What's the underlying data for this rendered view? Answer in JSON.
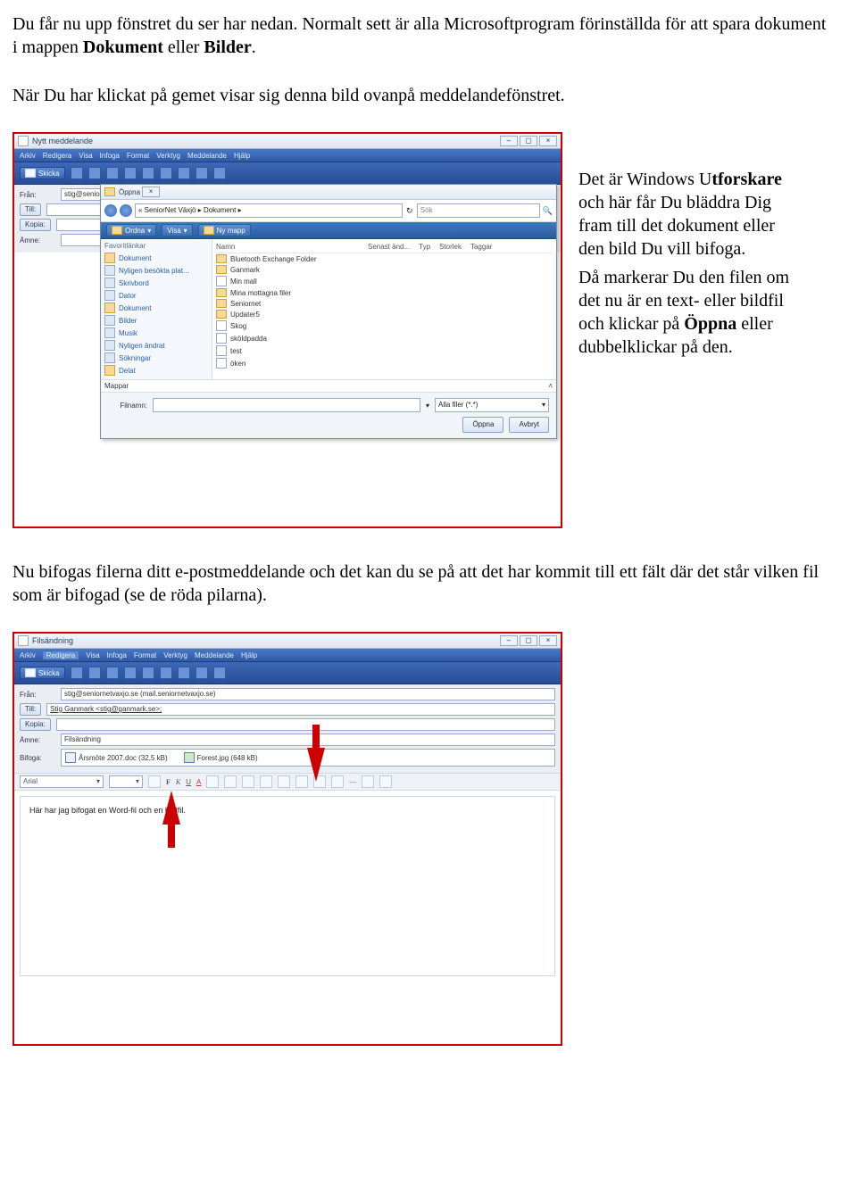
{
  "para1_a": "Du får nu upp fönstret du ser har nedan. Normalt sett är alla Microsoftprogram förinställda för att spara dokument i mappen ",
  "para1_b1": "Dokument",
  "para1_mid": " eller ",
  "para1_b2": "Bilder",
  "para1_end": ".",
  "para2": "När Du har klickat på gemet visar sig denna bild ovanpå meddelandefönstret.",
  "sidecap_a": "Det är Windows U",
  "sidecap_a2": "tforskare",
  "sidecap_a3": " och här får Du bläddra Dig fram till det dokument eller den bild Du vill bifoga.",
  "sidecap_b": "Då markerar Du den filen om det nu är en text- eller bildfil och klickar på ",
  "sidecap_b_bold": "Öppna",
  "sidecap_b_end": " eller dubbelklickar på den.",
  "para3": "Nu bifogas filerna ditt e-postmeddelande och det kan du se på att det har kommit till ett fält där det står vilken fil som är bifogad (se de röda pilarna).",
  "shot1": {
    "title": "Nytt meddelande",
    "menus": [
      "Arkiv",
      "Redigera",
      "Visa",
      "Infoga",
      "Format",
      "Verktyg",
      "Meddelande",
      "Hjälp"
    ],
    "send": "Skicka",
    "fran": "Från:",
    "franval": "stig@seniorn",
    "till": "Till:",
    "kopia": "Kopia:",
    "amne": "Ämne:"
  },
  "open": {
    "title": "Öppna",
    "breadcrumb": "« SeniorNet Växjö ▸ Dokument ▸",
    "search": "Sök",
    "ordna": "Ordna",
    "visa": "Visa",
    "nymapp": "Ny mapp",
    "favhead": "Favoritlänkar",
    "fav": [
      "Dokument",
      "Nyligen besökta plat...",
      "Skrivbord",
      "Dator",
      "Dokument",
      "Bilder",
      "Musik",
      "Nyligen ändrat",
      "Sökningar",
      "Delat"
    ],
    "cols": [
      "Namn",
      "Senast änd...",
      "Typ",
      "Storlek",
      "Taggar"
    ],
    "files": [
      {
        "t": "folder",
        "n": "Bluetooth Exchange Folder"
      },
      {
        "t": "folder",
        "n": "Ganmark"
      },
      {
        "t": "file",
        "n": "Min mall"
      },
      {
        "t": "folder",
        "n": "Mina mottagna filer"
      },
      {
        "t": "folder",
        "n": "Seniornet"
      },
      {
        "t": "folder",
        "n": "Updater5"
      },
      {
        "t": "file",
        "n": "Skog"
      },
      {
        "t": "file",
        "n": "sköldpadda"
      },
      {
        "t": "file",
        "n": "test"
      },
      {
        "t": "file",
        "n": "öken"
      }
    ],
    "mappar": "Mappar",
    "filnamn": "Filnamn:",
    "filter": "Alla filer (*.*)",
    "oppna": "Öppna",
    "avbryt": "Avbryt"
  },
  "shot2": {
    "title": "Filsändning",
    "menus": [
      "Arkiv",
      "Redigera",
      "Visa",
      "Infoga",
      "Format",
      "Verktyg",
      "Meddelande",
      "Hjälp"
    ],
    "send": "Skicka",
    "fran": "Från:",
    "franval": "stig@seniornetvaxjo.se    (mail.seniornetvaxjo.se)",
    "till": "Till:",
    "tillval": "Stig Ganmark <stig@ganmark.se>;",
    "kopia": "Kopia:",
    "amne": "Ämne:",
    "amneval": "Filsändning",
    "bifoga": "Bifoga:",
    "att1": "Årsmöte 2007.doc (32,5 kB)",
    "att2": "Forest.jpg (648 kB)",
    "font": "Arial",
    "body": "Här har jag bifogat en Word-fil och en bildfil."
  }
}
